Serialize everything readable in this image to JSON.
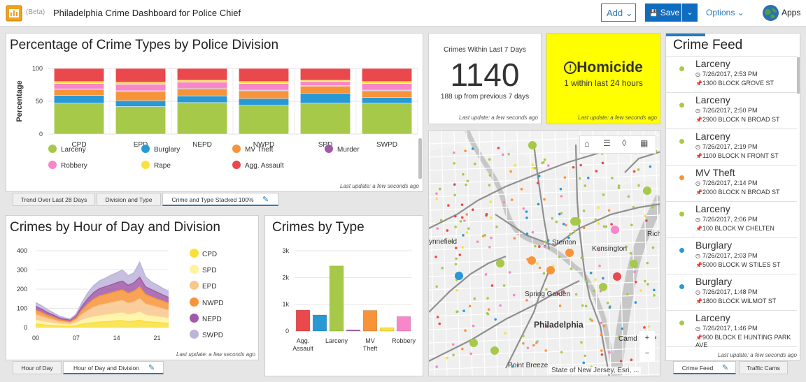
{
  "header": {
    "beta": "(Beta)",
    "title": "Philadelphia Crime Dashboard for Police Chief",
    "add": "Add",
    "save": "Save",
    "options": "Options",
    "apps": "Apps"
  },
  "colors": {
    "larceny": "#a6c94a",
    "burglary": "#2899d5",
    "mv_theft": "#f7943a",
    "murder": "#a05ba8",
    "robbery": "#f787c9",
    "rape": "#f8e23e",
    "agg_assault": "#e9484c",
    "highlight": "#ffff00",
    "accent": "#2a7ab8"
  },
  "stacked": {
    "title": "Percentage of Crime Types by Police Division",
    "last_update": "Last update: a few seconds ago",
    "legend": [
      {
        "label": "Larceny",
        "key": "larceny"
      },
      {
        "label": "Burglary",
        "key": "burglary"
      },
      {
        "label": "MV Theft",
        "key": "mv_theft"
      },
      {
        "label": "Murder",
        "key": "murder"
      },
      {
        "label": "Robbery",
        "key": "robbery"
      },
      {
        "label": "Rape",
        "key": "rape"
      },
      {
        "label": "Agg. Assault",
        "key": "agg_assault"
      }
    ],
    "tabs": [
      "Trend Over Last 28 Days",
      "Division and Type",
      "Crime and Type Stacked 100%"
    ]
  },
  "kpi": {
    "label": "Crimes Within Last 7 Days",
    "value": "1140",
    "sub": "188 up from previous 7 days",
    "last_update": "Last update: a few seconds ago"
  },
  "homicide": {
    "icon": "!",
    "title": "Homicide",
    "sub": "1 within last 24 hours",
    "last_update": "Last update: a few seconds ago"
  },
  "hourly": {
    "title": "Crimes by Hour of Day and Division",
    "last_update": "Last update: a few seconds ago",
    "legend": [
      {
        "label": "CPD",
        "color": "#f9df3a"
      },
      {
        "label": "SPD",
        "color": "#fff3a0"
      },
      {
        "label": "EPD",
        "color": "#f9c78c"
      },
      {
        "label": "NWPD",
        "color": "#f7943a"
      },
      {
        "label": "NEPD",
        "color": "#a05ba8"
      },
      {
        "label": "SWPD",
        "color": "#bdb4da"
      }
    ],
    "tabs": [
      "Hour of Day",
      "Hour of Day and Division"
    ]
  },
  "bytype": {
    "title": "Crimes by Type"
  },
  "map": {
    "labels": [
      "ynnefield",
      "Stenton",
      "Kensington",
      "Rich",
      "Spring Garden",
      "Philadelphia",
      "Camd",
      "Point Breeze"
    ],
    "attribution": "State of New Jersey, Esri, ...",
    "zoom_in": "+",
    "zoom_out": "−"
  },
  "feed": {
    "title": "Crime Feed",
    "tabs": [
      "Crime Feed",
      "Traffic Cams"
    ],
    "last_update": "Last update: a few seconds ago",
    "items": [
      {
        "type": "Larceny",
        "time": "7/26/2017, 2:53 PM",
        "addr": "1300 BLOCK GROVE ST",
        "color": "#a6c94a"
      },
      {
        "type": "Larceny",
        "time": "7/26/2017, 2:50 PM",
        "addr": "2900 BLOCK N BROAD ST",
        "color": "#a6c94a"
      },
      {
        "type": "Larceny",
        "time": "7/26/2017, 2:19 PM",
        "addr": "1100 BLOCK N FRONT ST",
        "color": "#a6c94a"
      },
      {
        "type": "MV Theft",
        "time": "7/26/2017, 2:14 PM",
        "addr": "2000 BLOCK N BROAD ST",
        "color": "#f7943a"
      },
      {
        "type": "Larceny",
        "time": "7/26/2017, 2:06 PM",
        "addr": "100 BLOCK W CHELTEN",
        "color": "#a6c94a"
      },
      {
        "type": "Burglary",
        "time": "7/26/2017, 2:03 PM",
        "addr": "5000 BLOCK W STILES ST",
        "color": "#2899d5"
      },
      {
        "type": "Burglary",
        "time": "7/26/2017, 1:48 PM",
        "addr": "1800 BLOCK WILMOT ST",
        "color": "#2899d5"
      },
      {
        "type": "Larceny",
        "time": "7/26/2017, 1:46 PM",
        "addr": "900 BLOCK E HUNTING PARK AVE",
        "color": "#a6c94a"
      }
    ]
  },
  "chart_data": [
    {
      "type": "bar",
      "stacked": "percent",
      "ylabel": "Percentage",
      "ylim": [
        0,
        100
      ],
      "yticks": [
        0,
        50,
        100
      ],
      "categories": [
        "CPD",
        "EPD",
        "NEPD",
        "NWPD",
        "SPD",
        "SWPD"
      ],
      "series": [
        {
          "name": "Larceny",
          "values": [
            47,
            42,
            48,
            44,
            47,
            47
          ]
        },
        {
          "name": "Burglary",
          "values": [
            12,
            9,
            10,
            10,
            15,
            9
          ]
        },
        {
          "name": "MV Theft",
          "values": [
            9,
            14,
            11,
            12,
            11,
            10
          ]
        },
        {
          "name": "Murder",
          "values": [
            1,
            1,
            1,
            1,
            1,
            1
          ]
        },
        {
          "name": "Robbery",
          "values": [
            8,
            10,
            9,
            10,
            6,
            10
          ]
        },
        {
          "name": "Rape",
          "values": [
            3,
            3,
            3,
            3,
            2,
            3
          ]
        },
        {
          "name": "Agg. Assault",
          "values": [
            20,
            21,
            18,
            20,
            18,
            20
          ]
        }
      ]
    },
    {
      "type": "area",
      "stacked": true,
      "ylim": [
        0,
        400
      ],
      "yticks": [
        0,
        100,
        200,
        300,
        400
      ],
      "xticks": [
        "00",
        "07",
        "14",
        "21"
      ],
      "x": [
        0,
        1,
        2,
        3,
        4,
        5,
        6,
        7,
        8,
        9,
        10,
        11,
        12,
        13,
        14,
        15,
        16,
        17,
        18,
        19,
        20,
        21,
        22,
        23
      ],
      "series": [
        {
          "name": "CPD",
          "values": [
            18,
            15,
            12,
            10,
            8,
            7,
            6,
            10,
            18,
            22,
            25,
            28,
            30,
            32,
            35,
            36,
            30,
            33,
            38,
            30,
            28,
            26,
            24,
            22
          ]
        },
        {
          "name": "SPD",
          "values": [
            20,
            17,
            14,
            12,
            9,
            8,
            7,
            12,
            20,
            26,
            30,
            32,
            34,
            36,
            38,
            40,
            36,
            38,
            42,
            34,
            32,
            30,
            28,
            26
          ]
        },
        {
          "name": "EPD",
          "values": [
            30,
            26,
            22,
            18,
            14,
            12,
            10,
            16,
            30,
            40,
            50,
            56,
            58,
            60,
            62,
            64,
            60,
            62,
            70,
            58,
            54,
            50,
            46,
            42
          ]
        },
        {
          "name": "NWPD",
          "values": [
            22,
            20,
            16,
            14,
            10,
            8,
            8,
            12,
            22,
            34,
            42,
            48,
            50,
            52,
            54,
            56,
            52,
            56,
            62,
            50,
            46,
            42,
            40,
            36
          ]
        },
        {
          "name": "NEPD",
          "values": [
            20,
            18,
            15,
            12,
            10,
            8,
            7,
            10,
            20,
            28,
            34,
            38,
            40,
            42,
            44,
            46,
            42,
            44,
            50,
            40,
            38,
            36,
            32,
            30
          ]
        },
        {
          "name": "SWPD",
          "values": [
            20,
            18,
            15,
            12,
            10,
            8,
            7,
            10,
            20,
            30,
            36,
            40,
            44,
            50,
            52,
            58,
            50,
            52,
            78,
            52,
            40,
            38,
            34,
            32
          ]
        }
      ]
    },
    {
      "type": "bar",
      "ylim": [
        0,
        3000
      ],
      "yticks": [
        "0",
        "1k",
        "2k",
        "3k"
      ],
      "categories": [
        "Agg. Assault",
        "Burglary",
        "Larceny",
        "Murder",
        "MV Theft",
        "Rape",
        "Robbery"
      ],
      "values": [
        780,
        600,
        2430,
        40,
        770,
        120,
        540
      ],
      "xlabels": [
        [
          "Agg.",
          "Assault"
        ],
        [
          ""
        ],
        [
          "Larceny"
        ],
        [
          ""
        ],
        [
          "MV",
          "Theft"
        ],
        [
          ""
        ],
        [
          "Robbery"
        ]
      ]
    }
  ]
}
